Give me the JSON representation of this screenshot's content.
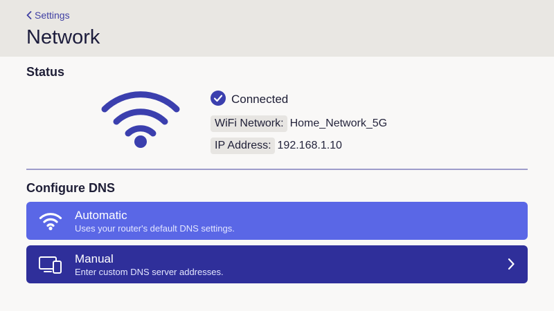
{
  "header": {
    "back_label": "Settings",
    "title": "Network"
  },
  "status": {
    "heading": "Status",
    "connection_state": "Connected",
    "network_label": "WiFi Network:",
    "network_value": "Home_Network_5G",
    "ip_label": "IP Address:",
    "ip_value": "192.168.1.10",
    "icons": [
      "wifi-icon",
      "checkmark-circle-icon"
    ]
  },
  "dns": {
    "heading": "Configure DNS",
    "options": [
      {
        "title": "Automatic",
        "subtitle": "Uses your router's default DNS settings.",
        "icon": "wifi-icon",
        "selected": true
      },
      {
        "title": "Manual",
        "subtitle": "Enter custom DNS server addresses.",
        "icon": "devices-icon",
        "has_chevron": true
      }
    ]
  },
  "colors": {
    "accent": "#3f3fa3",
    "automatic_bg": "#5a67e6",
    "manual_bg": "#2f2f9a",
    "header_bg": "#e9e7e3",
    "page_bg": "#f9f8f7"
  }
}
